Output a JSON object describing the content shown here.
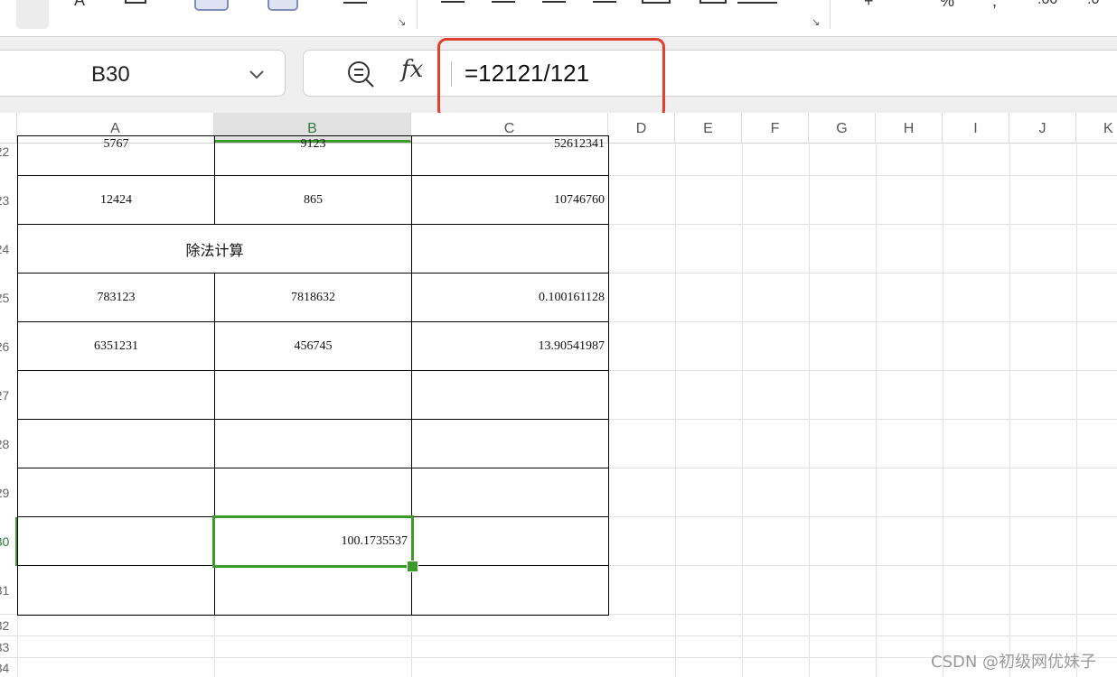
{
  "name_box": {
    "value": "B30"
  },
  "formula_bar": {
    "formula": "=12121/121",
    "fx_label": "fx"
  },
  "columns": [
    "A",
    "B",
    "C",
    "D",
    "E",
    "F",
    "G",
    "H",
    "I",
    "J",
    "K"
  ],
  "selected_column": "B",
  "rows": [
    {
      "num": "22",
      "a": "5767",
      "b": "9123",
      "c": "52612341"
    },
    {
      "num": "23",
      "a": "12424",
      "b": "865",
      "c": "10746760"
    },
    {
      "num": "24",
      "merged_title": "除法计算",
      "c": ""
    },
    {
      "num": "25",
      "a": "783123",
      "b": "7818632",
      "c": "0.100161128"
    },
    {
      "num": "26",
      "a": "6351231",
      "b": "456745",
      "c": "13.90541987"
    },
    {
      "num": "27",
      "a": "",
      "b": "",
      "c": ""
    },
    {
      "num": "28",
      "a": "",
      "b": "",
      "c": ""
    },
    {
      "num": "29",
      "a": "",
      "b": "",
      "c": ""
    },
    {
      "num": "30",
      "a": "",
      "b": "100.1735537",
      "c": ""
    },
    {
      "num": "31",
      "a": "",
      "b": "",
      "c": ""
    }
  ],
  "extra_rows": [
    "32",
    "33",
    "34"
  ],
  "selected_row": "30",
  "colors": {
    "accent_green": "#3c9a2b",
    "highlight_red": "#e0402f"
  },
  "watermark": "CSDN @初级网优妹子"
}
